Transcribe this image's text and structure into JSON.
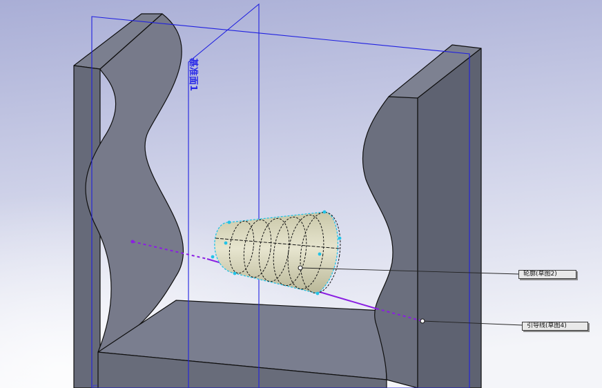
{
  "viewport": {
    "plane_label": "基准面1",
    "callouts": {
      "profile": "轮廓(草图2)",
      "path": "引导线(草图4)"
    }
  },
  "colors": {
    "background_top": "#a9aed6",
    "background_bottom": "#f2f3f8",
    "part_front": "#6a6e7e",
    "part_edge": "#0e0e0e",
    "plane_line": "#1f1fe0",
    "sweep_path": "#8a1ee2",
    "profile_preview": "#d9d7bf",
    "selection_highlight": "#23c3e6"
  }
}
